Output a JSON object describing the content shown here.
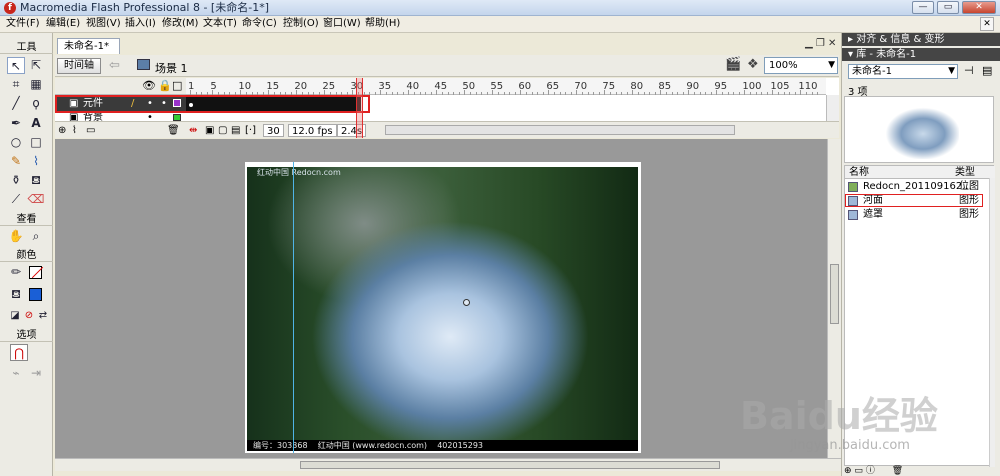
{
  "window": {
    "title": "Macromedia Flash Professional 8 - [未命名-1*]",
    "app_icon_glyph": "f",
    "minimize": "—",
    "maximize": "▭",
    "close": "✕"
  },
  "menu": {
    "items": [
      "文件(F)",
      "编辑(E)",
      "视图(V)",
      "插入(I)",
      "修改(M)",
      "文本(T)",
      "命令(C)",
      "控制(O)",
      "窗口(W)",
      "帮助(H)"
    ],
    "close": "✕"
  },
  "toolbox": {
    "tools_header": "工具",
    "view_header": "查看",
    "colors_header": "颜色",
    "options_header": "选项",
    "tool_icons": [
      "arrow-icon",
      "subselect-icon",
      "free-transform-icon",
      "fill-transform-icon",
      "line-icon",
      "lasso-icon",
      "pen-icon",
      "text-icon",
      "oval-icon",
      "rectangle-icon",
      "pencil-icon",
      "brush-icon",
      "ink-bottle-icon",
      "paint-bucket-icon",
      "eyedropper-icon",
      "eraser-icon"
    ],
    "stroke_color": "#000000",
    "fill_color": "#1a5fd6"
  },
  "document": {
    "tab": "未命名-1*",
    "timeline_button": "时间轴",
    "scene": "场景 1",
    "zoom": "100%"
  },
  "timeline": {
    "frame_numbers": [
      "1",
      "5",
      "10",
      "15",
      "20",
      "25",
      "30",
      "35",
      "40",
      "45",
      "50",
      "55",
      "60",
      "65",
      "70",
      "75",
      "80",
      "85",
      "90",
      "95",
      "100",
      "105",
      "110"
    ],
    "layers": [
      {
        "name": "元件",
        "selected": true
      },
      {
        "name": "背景",
        "selected": false
      }
    ],
    "current_frame": "30",
    "fps": "12.0 fps",
    "time": "2.4s"
  },
  "stage": {
    "photo_top_text": "红动中国  Redocn.com",
    "photo_bottom_text": "编号：303368    红动中国 (www.redocn.com)    402015293"
  },
  "right_panel": {
    "align_header": "▸ 对齐 & 信息 & 变形",
    "library_header": "▾ 库 - 未命名-1",
    "library_select": "未命名-1",
    "item_count": "3 项",
    "col_name": "名称",
    "col_type": "类型",
    "items": [
      {
        "name": "Redocn_201109162...",
        "type": "位图"
      },
      {
        "name": "河面",
        "type": "图形"
      },
      {
        "name": "遮罩",
        "type": "图形"
      }
    ]
  },
  "watermark": {
    "logo_text": "Baidu经验",
    "url": "jingyan.baidu.com"
  }
}
